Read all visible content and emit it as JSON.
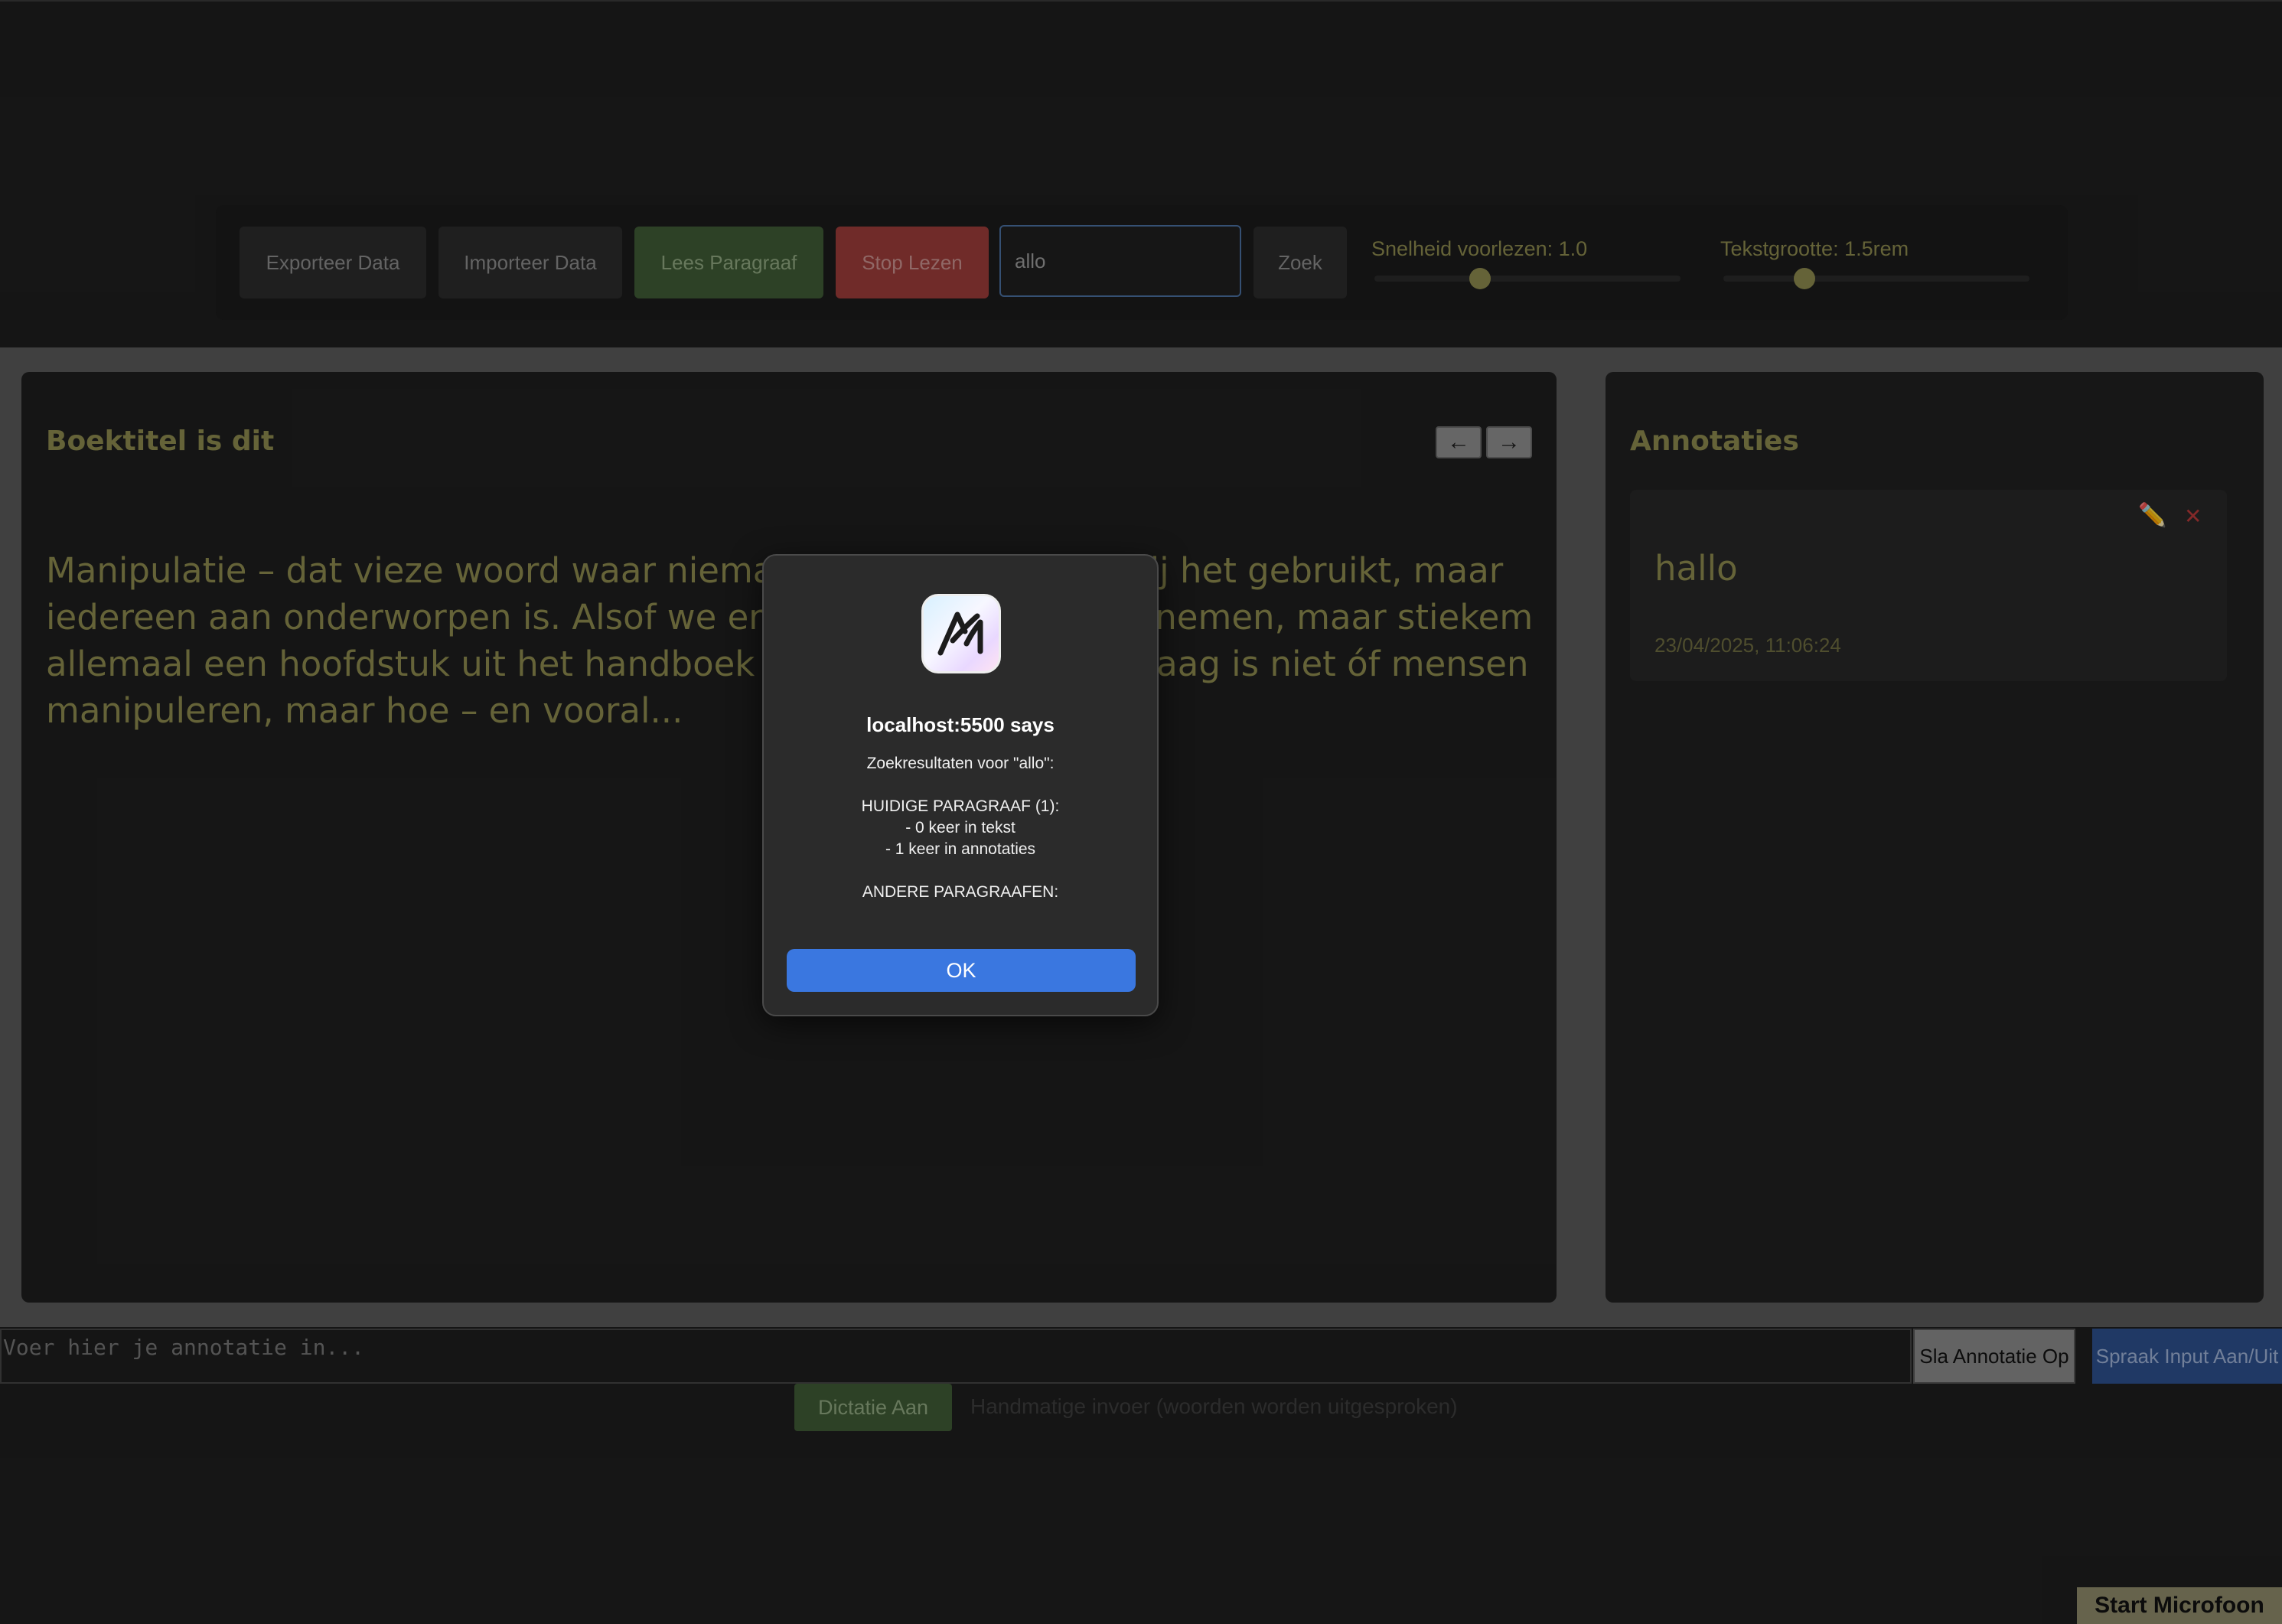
{
  "toolbar": {
    "export_label": "Exporteer Data",
    "import_label": "Importeer Data",
    "read_label": "Lees Paragraaf",
    "stop_label": "Stop Lezen",
    "search_value": "allo",
    "search_label": "Zoek",
    "speed_label": "Snelheid voorlezen: 1.0",
    "speed_value": 1.0,
    "textsize_label": "Tekstgrootte: 1.5rem",
    "textsize_value": 1.5
  },
  "book": {
    "title": "Boektitel is dit",
    "prev_icon": "←",
    "next_icon": "→",
    "paragraph": "Manipulatie – dat vieze woord waar niemand ooit toegeeft dat hij het gebruikt, maar iedereen aan onderworpen is. Alsof we er collectief afstand van nemen, maar stiekem allemaal een hoofdstuk uit het handboek gelezen hebben. De vraag is niet óf mensen manipuleren, maar hoe – en vooral..."
  },
  "annotations": {
    "title": "Annotaties",
    "items": [
      {
        "text": "hallo",
        "date": "23/04/2025, 11:06:24",
        "edit_icon": "✏️",
        "delete_icon": "✕"
      }
    ]
  },
  "input_row": {
    "placeholder": "Voer hier je annotatie in...",
    "save_label": "Sla Annotatie Op",
    "speech_label": "Spraak Input Aan/Uit",
    "dictation_label": "Dictatie Aan",
    "manual_text": "Handmatige invoer (woorden worden uitgesproken)",
    "mic_label": "Start Microfoon"
  },
  "dialog": {
    "title": "localhost:5500 says",
    "line1": "Zoekresultaten voor \"allo\":",
    "line2": "HUIDIGE PARAGRAAF (1):",
    "line3": "- 0 keer in tekst",
    "line4": "- 1 keer in annotaties",
    "line5": "ANDERE PARAGRAAFEN:",
    "ok_label": "OK"
  }
}
